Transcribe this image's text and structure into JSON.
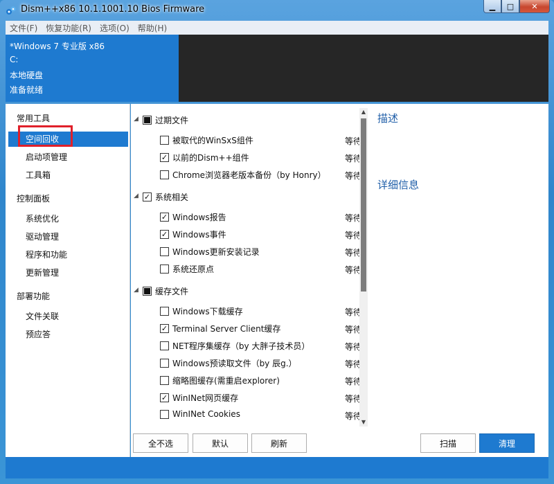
{
  "window": {
    "title": "Dism++x86 10.1.1001.10 Bios Firmware"
  },
  "caption": {
    "minimize": "▁",
    "maximize": "□",
    "close": "✕"
  },
  "menu": [
    "文件(F)",
    "恢复功能(R)",
    "选项(O)",
    "帮助(H)"
  ],
  "info": [
    "*Windows 7 专业版 x86",
    "C:",
    "本地硬盘",
    "准备就绪"
  ],
  "sidebar": {
    "groups": [
      {
        "label": "常用工具",
        "items": [
          "空间回收",
          "启动项管理",
          "工具箱"
        ]
      },
      {
        "label": "控制面板",
        "items": [
          "系统优化",
          "驱动管理",
          "程序和功能",
          "更新管理"
        ]
      },
      {
        "label": "部署功能",
        "items": [
          "文件关联",
          "预应答"
        ]
      }
    ],
    "active": "空间回收"
  },
  "categories": [
    {
      "label": "过期文件",
      "state": "partial",
      "items": [
        {
          "label": "被取代的WinSxS组件",
          "checked": false,
          "status": "等待"
        },
        {
          "label": "以前的Dism++组件",
          "checked": true,
          "status": "等待"
        },
        {
          "label": "Chrome浏览器老版本备份（by Honry）",
          "checked": false,
          "status": "等待"
        }
      ]
    },
    {
      "label": "系统相关",
      "state": "checked",
      "items": [
        {
          "label": "Windows报告",
          "checked": true,
          "status": "等待"
        },
        {
          "label": "Windows事件",
          "checked": true,
          "status": "等待"
        },
        {
          "label": "Windows更新安装记录",
          "checked": false,
          "status": "等待"
        },
        {
          "label": "系统还原点",
          "checked": false,
          "status": "等待"
        }
      ]
    },
    {
      "label": "缓存文件",
      "state": "partial",
      "items": [
        {
          "label": "Windows下载缓存",
          "checked": false,
          "status": "等待"
        },
        {
          "label": "Terminal Server Client缓存",
          "checked": true,
          "status": "等待"
        },
        {
          "label": "NET程序集缓存（by 大胖子技术员）",
          "checked": false,
          "status": "等待"
        },
        {
          "label": "Windows预读取文件（by 辰g.）",
          "checked": false,
          "status": "等待"
        },
        {
          "label": "缩略图缓存(需重启explorer)",
          "checked": false,
          "status": "等待"
        },
        {
          "label": "WinINet网页缓存",
          "checked": true,
          "status": "等待"
        },
        {
          "label": "WinINet Cookies",
          "checked": false,
          "status": "等待"
        }
      ]
    }
  ],
  "details": {
    "desc_title": "描述",
    "detail_title": "详细信息"
  },
  "buttons": {
    "deselect_all": "全不选",
    "default": "默认",
    "refresh": "刷新",
    "scan": "扫描",
    "clean": "清理"
  },
  "icons": {
    "app": "dism-gear-icon",
    "check": "check-icon",
    "collapse": "triangle-down-icon",
    "scroll_up": "scroll-up-icon",
    "scroll_down": "scroll-down-icon"
  }
}
